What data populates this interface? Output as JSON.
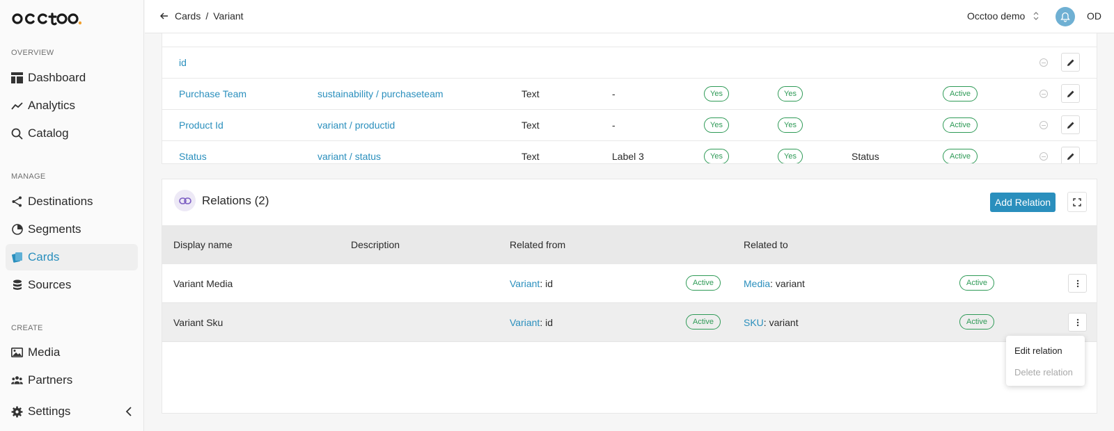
{
  "app": {
    "logo_text": "occtoo."
  },
  "sidebar": {
    "sections": [
      {
        "label": "OVERVIEW"
      },
      {
        "label": "MANAGE"
      },
      {
        "label": "CREATE"
      }
    ],
    "items": [
      {
        "label": "Dashboard",
        "icon": "dashboard-icon"
      },
      {
        "label": "Analytics",
        "icon": "analytics-icon"
      },
      {
        "label": "Catalog",
        "icon": "search-icon"
      },
      {
        "label": "Destinations",
        "icon": "share-icon"
      },
      {
        "label": "Segments",
        "icon": "pie-chart-icon"
      },
      {
        "label": "Cards",
        "icon": "cards-icon",
        "active": true
      },
      {
        "label": "Sources",
        "icon": "database-icon"
      },
      {
        "label": "Media",
        "icon": "image-icon"
      },
      {
        "label": "Partners",
        "icon": "people-icon"
      },
      {
        "label": "Settings",
        "icon": "gear-icon"
      }
    ]
  },
  "header": {
    "breadcrumb": [
      "Cards",
      "Variant"
    ],
    "separator": "/",
    "tenant": "Occtoo demo",
    "user_initials": "OD"
  },
  "attributes": {
    "rows": [
      {
        "name": "id",
        "source": "",
        "type": "",
        "label": "",
        "yes1": "",
        "yes2": "",
        "extra": "",
        "status": ""
      },
      {
        "name": "Purchase Team",
        "source": "sustainability / purchaseteam",
        "type": "Text",
        "label": "-",
        "yes1": "Yes",
        "yes2": "Yes",
        "extra": "",
        "status": "Active"
      },
      {
        "name": "Product Id",
        "source": "variant / productid",
        "type": "Text",
        "label": "-",
        "yes1": "Yes",
        "yes2": "Yes",
        "extra": "",
        "status": "Active"
      },
      {
        "name": "Status",
        "source": "variant / status",
        "type": "Text",
        "label": "Label 3",
        "yes1": "Yes",
        "yes2": "Yes",
        "extra": "Status",
        "status": "Active"
      }
    ]
  },
  "relations": {
    "title": "Relations (2)",
    "add_button": "Add Relation",
    "columns": [
      "Display name",
      "Description",
      "Related from",
      "Related to"
    ],
    "rows": [
      {
        "display_name": "Variant Media",
        "description": "",
        "from_entity": "Variant",
        "from_field": ": id",
        "from_status": "Active",
        "to_entity": "Media",
        "to_field": ": variant",
        "to_status": "Active"
      },
      {
        "display_name": "Variant Sku",
        "description": "",
        "from_entity": "Variant",
        "from_field": ": id",
        "from_status": "Active",
        "to_entity": "SKU",
        "to_field": ": variant",
        "to_status": "Active"
      }
    ],
    "menu": {
      "edit": "Edit relation",
      "delete": "Delete relation"
    }
  },
  "colors": {
    "accent": "#2a8fbd",
    "success": "#2e9a56",
    "logo_dot": "#f0a030"
  }
}
